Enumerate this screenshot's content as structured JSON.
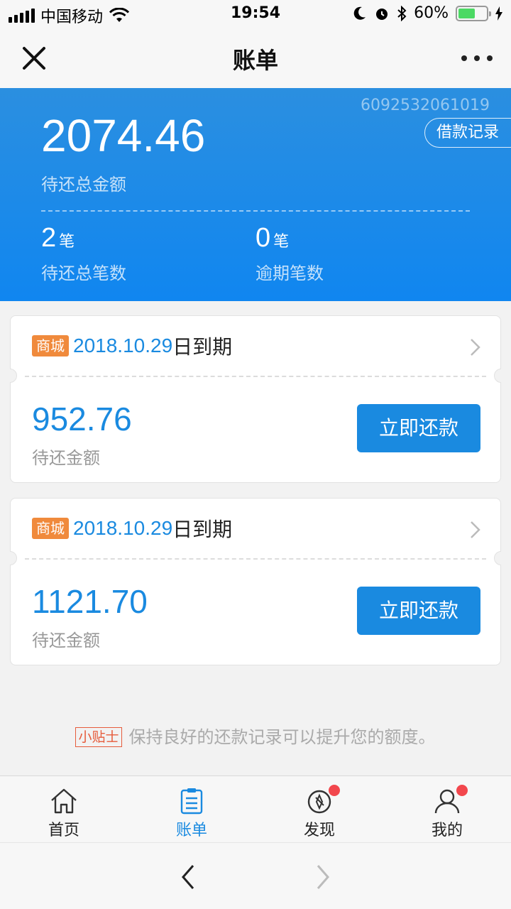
{
  "status_bar": {
    "carrier": "中国移动",
    "time": "19:54",
    "battery": "60%",
    "battery_level": 0.6
  },
  "nav": {
    "title": "账单",
    "close_icon": "close-icon",
    "more_icon": "more-icon"
  },
  "summary": {
    "account_no": "6092532061019",
    "loan_record_label": "借款记录",
    "total_amount": "2074.46",
    "total_label": "待还总金额",
    "pending_count": "2",
    "pending_unit": "笔",
    "pending_label": "待还总笔数",
    "overdue_count": "0",
    "overdue_unit": "笔",
    "overdue_label": "逾期笔数"
  },
  "bills": [
    {
      "tag": "商城",
      "due_date": "2018.10.29",
      "due_suffix": "日到期",
      "amount": "952.76",
      "amount_label": "待还金额",
      "button": "立即还款"
    },
    {
      "tag": "商城",
      "due_date": "2018.10.29",
      "due_suffix": "日到期",
      "amount": "1121.70",
      "amount_label": "待还金额",
      "button": "立即还款"
    }
  ],
  "tip": {
    "tag": "小贴士",
    "text": "保持良好的还款记录可以提升您的额度。"
  },
  "tabs": [
    {
      "label": "首页",
      "icon": "home-icon",
      "active": false,
      "badge": false
    },
    {
      "label": "账单",
      "icon": "bill-icon",
      "active": true,
      "badge": false
    },
    {
      "label": "发现",
      "icon": "compass-icon",
      "active": false,
      "badge": true
    },
    {
      "label": "我的",
      "icon": "user-icon",
      "active": false,
      "badge": true
    }
  ],
  "colors": {
    "primary": "#1a8ae0",
    "header_bg": "#1086f0",
    "tag_orange": "#f08a3c",
    "tip_red": "#e65c3c",
    "badge_red": "#f2474d"
  }
}
